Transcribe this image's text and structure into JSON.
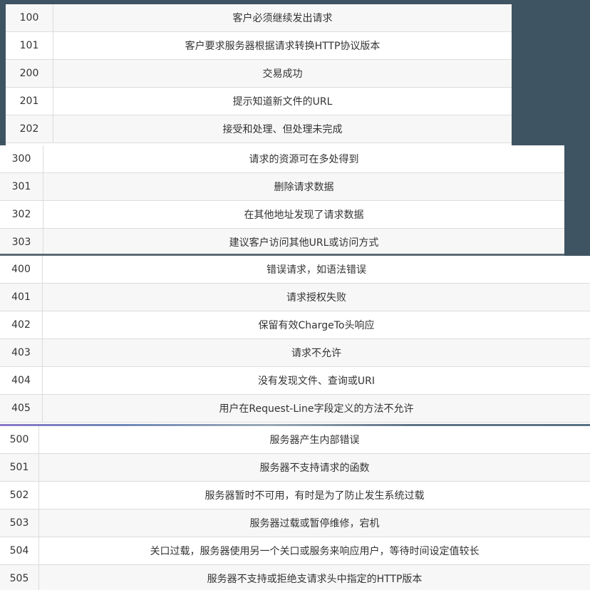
{
  "tables": {
    "group_1xx_2xx": {
      "rows": [
        {
          "code": "100",
          "desc": "客户必须继续发出请求"
        },
        {
          "code": "101",
          "desc": "客户要求服务器根据请求转换HTTP协议版本"
        },
        {
          "code": "200",
          "desc": "交易成功"
        },
        {
          "code": "201",
          "desc": "提示知道新文件的URL"
        },
        {
          "code": "202",
          "desc": "接受和处理、但处理未完成"
        }
      ]
    },
    "group_3xx": {
      "rows": [
        {
          "code": "300",
          "desc": "请求的资源可在多处得到"
        },
        {
          "code": "301",
          "desc": "删除请求数据"
        },
        {
          "code": "302",
          "desc": "在其他地址发现了请求数据"
        },
        {
          "code": "303",
          "desc": "建议客户访问其他URL或访问方式"
        }
      ]
    },
    "group_4xx": {
      "rows": [
        {
          "code": "400",
          "desc": "错误请求，如语法错误"
        },
        {
          "code": "401",
          "desc": "请求授权失败"
        },
        {
          "code": "402",
          "desc": "保留有效ChargeTo头响应"
        },
        {
          "code": "403",
          "desc": "请求不允许"
        },
        {
          "code": "404",
          "desc": "没有发现文件、查询或URI"
        },
        {
          "code": "405",
          "desc": "用户在Request-Line字段定义的方法不允许"
        }
      ]
    },
    "group_5xx": {
      "rows": [
        {
          "code": "500",
          "desc": "服务器产生内部错误"
        },
        {
          "code": "501",
          "desc": "服务器不支持请求的函数"
        },
        {
          "code": "502",
          "desc": "服务器暂时不可用，有时是为了防止发生系统过载"
        },
        {
          "code": "503",
          "desc": "服务器过载或暂停维修，宕机"
        },
        {
          "code": "504",
          "desc": "关口过载，服务器使用另一个关口或服务来响应用户，等待时间设定值较长"
        },
        {
          "code": "505",
          "desc": "服务器不支持或拒绝支请求头中指定的HTTP版本"
        }
      ]
    }
  },
  "colors": {
    "background": "#3f5462",
    "row_alt": "#f7f7f7",
    "row": "#ffffff",
    "border": "#dcdcdc",
    "text": "#333333"
  }
}
